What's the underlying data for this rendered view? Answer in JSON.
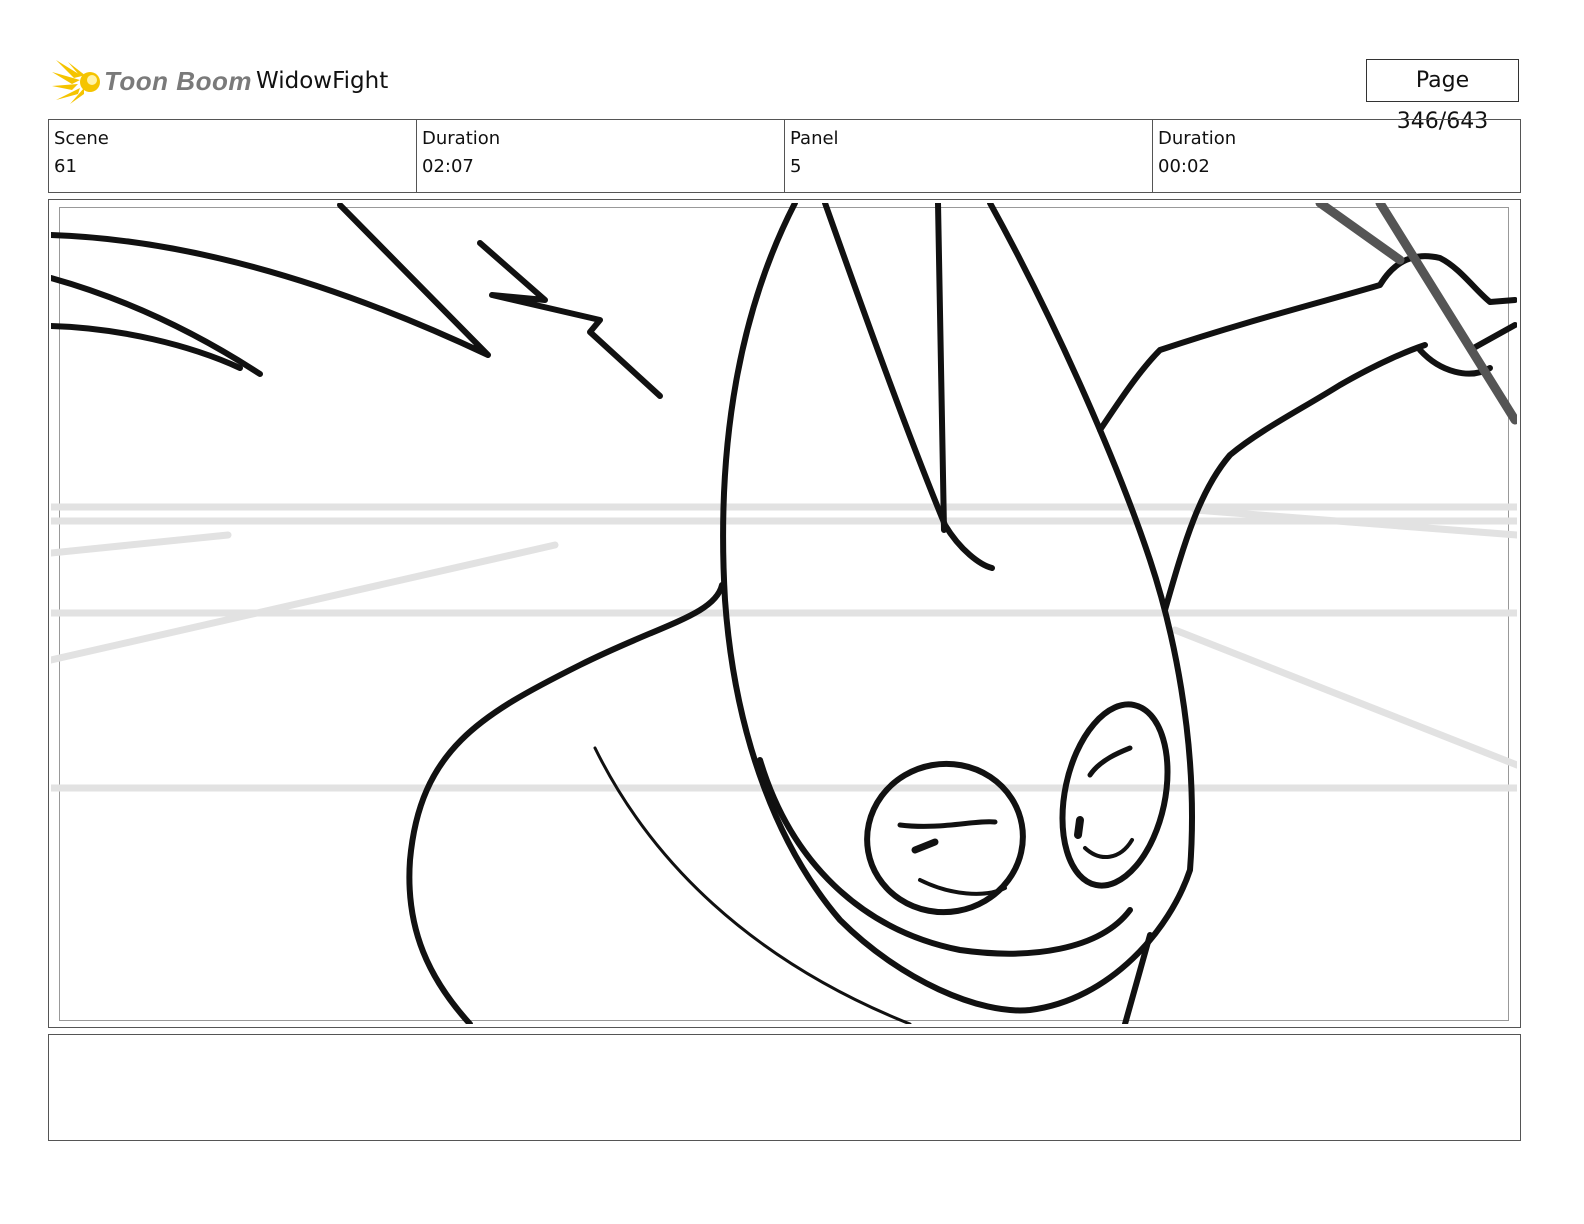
{
  "header": {
    "logo_text": "Toon Boom",
    "project_title": "WidowFight",
    "page_indicator": "Page 346/643"
  },
  "info": {
    "scene_label": "Scene",
    "scene_value": "61",
    "scene_duration_label": "Duration",
    "scene_duration_value": "02:07",
    "panel_label": "Panel",
    "panel_value": "5",
    "panel_duration_label": "Duration",
    "panel_duration_value": "00:02"
  },
  "caption": {
    "text": ""
  },
  "colors": {
    "logo_burst": "#f5c400",
    "logo_text": "#7a7a7a",
    "sketch_line": "#111111",
    "background_line": "#e2e2e2"
  }
}
